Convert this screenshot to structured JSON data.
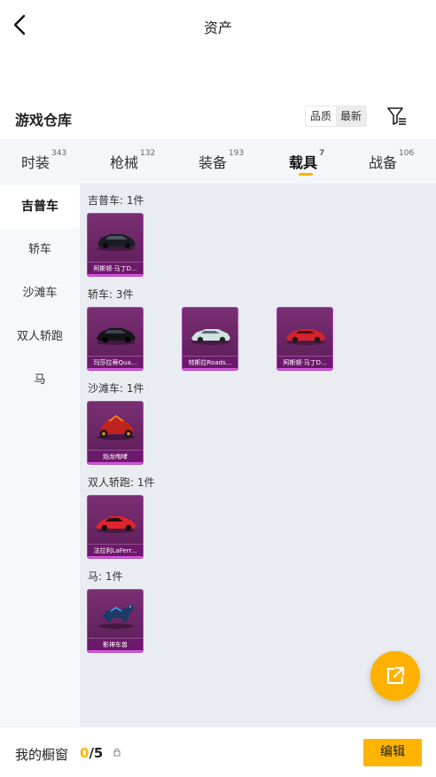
{
  "header": {
    "title": "资产"
  },
  "section": {
    "title": "游戏仓库",
    "sort_options": [
      "品质",
      "最新"
    ],
    "selected_sort": "最新"
  },
  "tabs": [
    {
      "label": "时装",
      "count": "343"
    },
    {
      "label": "枪械",
      "count": "132"
    },
    {
      "label": "装备",
      "count": "193"
    },
    {
      "label": "载具",
      "count": "7",
      "active": true
    },
    {
      "label": "战备",
      "count": "106"
    }
  ],
  "sidebar": {
    "items": [
      {
        "label": "吉普车",
        "active": true
      },
      {
        "label": "轿车"
      },
      {
        "label": "沙滩车"
      },
      {
        "label": "双人轿跑"
      },
      {
        "label": "马"
      }
    ]
  },
  "groups": [
    {
      "label": "吉普车: 1件",
      "items": [
        {
          "name": "阿斯顿·马丁D...",
          "kind": "dark-sedan"
        }
      ]
    },
    {
      "label": "轿车: 3件",
      "items": [
        {
          "name": "玛莎拉蒂Qua...",
          "kind": "dark-sedan"
        },
        {
          "name": "特斯拉Roads...",
          "kind": "white-roadster"
        },
        {
          "name": "阿斯顿·马丁D...",
          "kind": "red-coupe"
        }
      ]
    },
    {
      "label": "沙滩车: 1件",
      "items": [
        {
          "name": "焰龙咆哮",
          "kind": "red-buggy"
        }
      ]
    },
    {
      "label": "双人轿跑: 1件",
      "items": [
        {
          "name": "法拉利LaFerr...",
          "kind": "red-supercar"
        }
      ]
    },
    {
      "label": "马: 1件",
      "items": [
        {
          "name": "影神车兽",
          "kind": "beast"
        }
      ]
    }
  ],
  "bottom": {
    "label": "我的橱窗",
    "current": "0",
    "separator": "/",
    "total": "5",
    "edit_label": "编辑"
  },
  "colors": {
    "accent": "#ffb400",
    "card_purple": "#6a2465",
    "card_border": "#b040c0"
  }
}
